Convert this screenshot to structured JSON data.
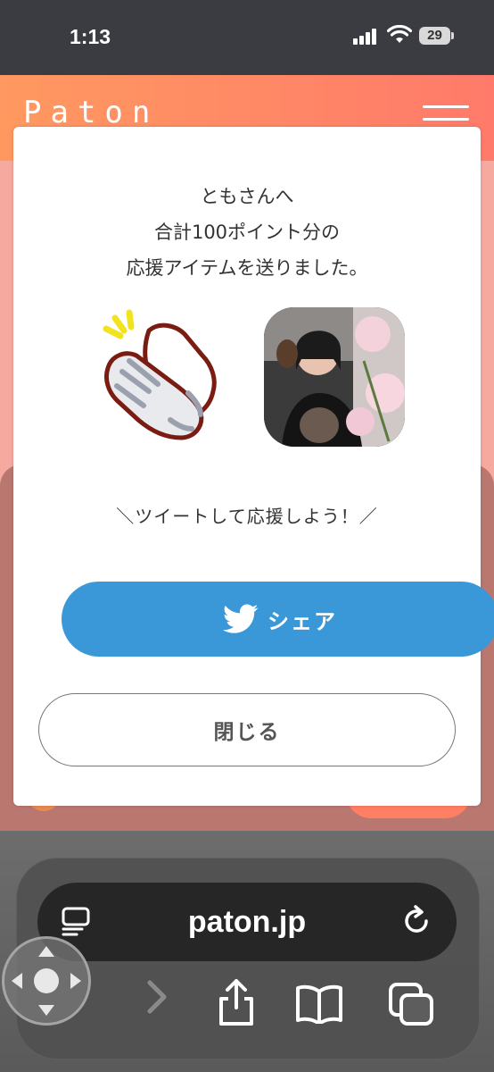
{
  "status_bar": {
    "time": "1:13",
    "battery_level": "29"
  },
  "app": {
    "brand": "Paton",
    "menu_icon": "hamburger-icon",
    "accent_color": "#ff7f63"
  },
  "modal": {
    "message_lines": [
      "ともさんへ",
      "合計100ポイント分の",
      "応援アイテムを送りました。"
    ],
    "item_icon": "clapping-hands-icon",
    "tweet_prompt": "＼ツイートして応援しよう！／",
    "share_button": {
      "label": "シェア",
      "icon": "twitter-bird-icon",
      "color": "#3a98d8"
    },
    "close_button": {
      "label": "閉じる"
    }
  },
  "browser": {
    "url": "paton.jp",
    "icons": [
      "reader-icon",
      "reload-icon",
      "back-icon",
      "forward-icon",
      "share-icon",
      "bookmarks-icon",
      "tabs-icon"
    ]
  }
}
